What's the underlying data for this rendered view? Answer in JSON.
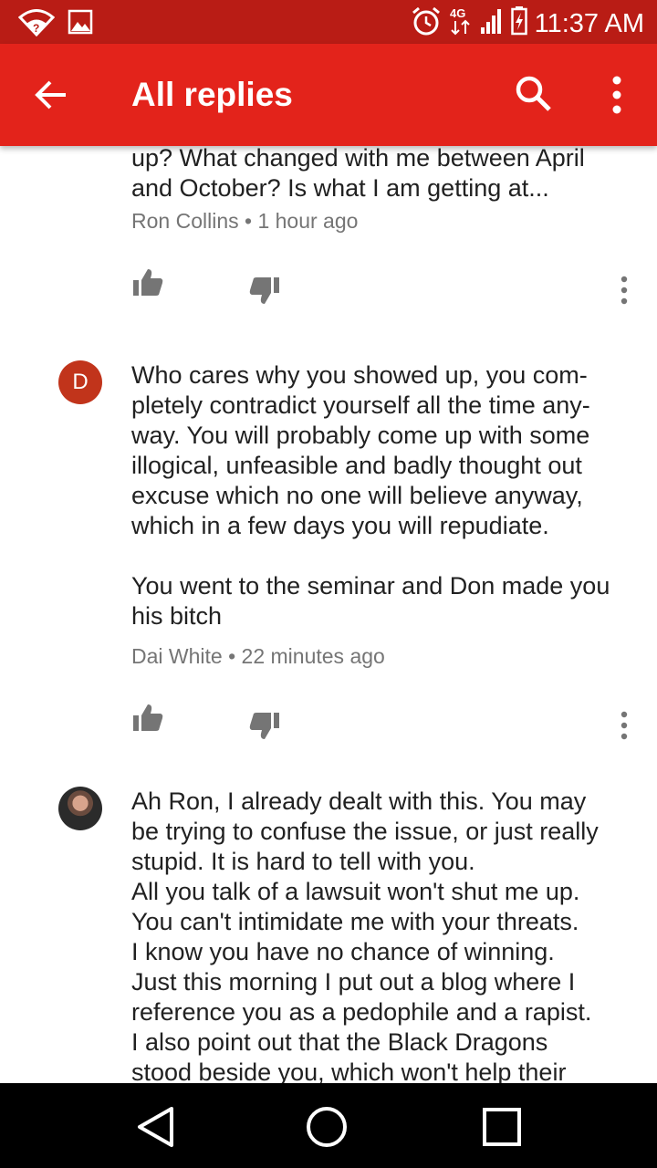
{
  "status_bar": {
    "time": "11:37 AM",
    "icons": [
      "wifi-icon",
      "image-notification-icon",
      "alarm-icon",
      "4g-icon",
      "signal-icon",
      "battery-charging-icon"
    ],
    "network_label": "4G"
  },
  "app_bar": {
    "title": "All replies",
    "icons": [
      "back-arrow-icon",
      "search-icon",
      "more-vert-icon"
    ],
    "color": "#e3231b"
  },
  "comments": [
    {
      "text": "up? What changed with me between April\nand October? Is what I am getting at...",
      "author": "Ron Collins",
      "separator": "•",
      "time": "1 hour ago"
    },
    {
      "avatar_letter": "D",
      "avatar_color": "#c1341b",
      "text": "Who cares why you showed up, you com-\npletely contradict yourself all the time any-\nway. You will probably come up with some\nillogical, unfeasible and badly thought out\nexcuse which no one will believe anyway,\nwhich in a few days you will repudiate.\n\nYou went to the seminar and Don made you\nhis bitch",
      "author": "Dai White",
      "separator": "•",
      "time": "22 minutes ago"
    },
    {
      "avatar": "profile-photo",
      "text": "Ah Ron, I already dealt with this. You may\nbe trying to confuse the issue, or just really\nstupid. It is hard to tell with you.\nAll you talk of a lawsuit won't shut me up.\nYou can't intimidate me with your threats.\nI know you have no chance of winning.\nJust this morning I put out a blog where I\nreference you as a pedophile and a rapist.\nI also point out that the Black Dragons\nstood beside you, which won't help their"
    }
  ],
  "nav_bar": {
    "icons": [
      "back-triangle-icon",
      "home-circle-icon",
      "recents-square-icon"
    ]
  }
}
